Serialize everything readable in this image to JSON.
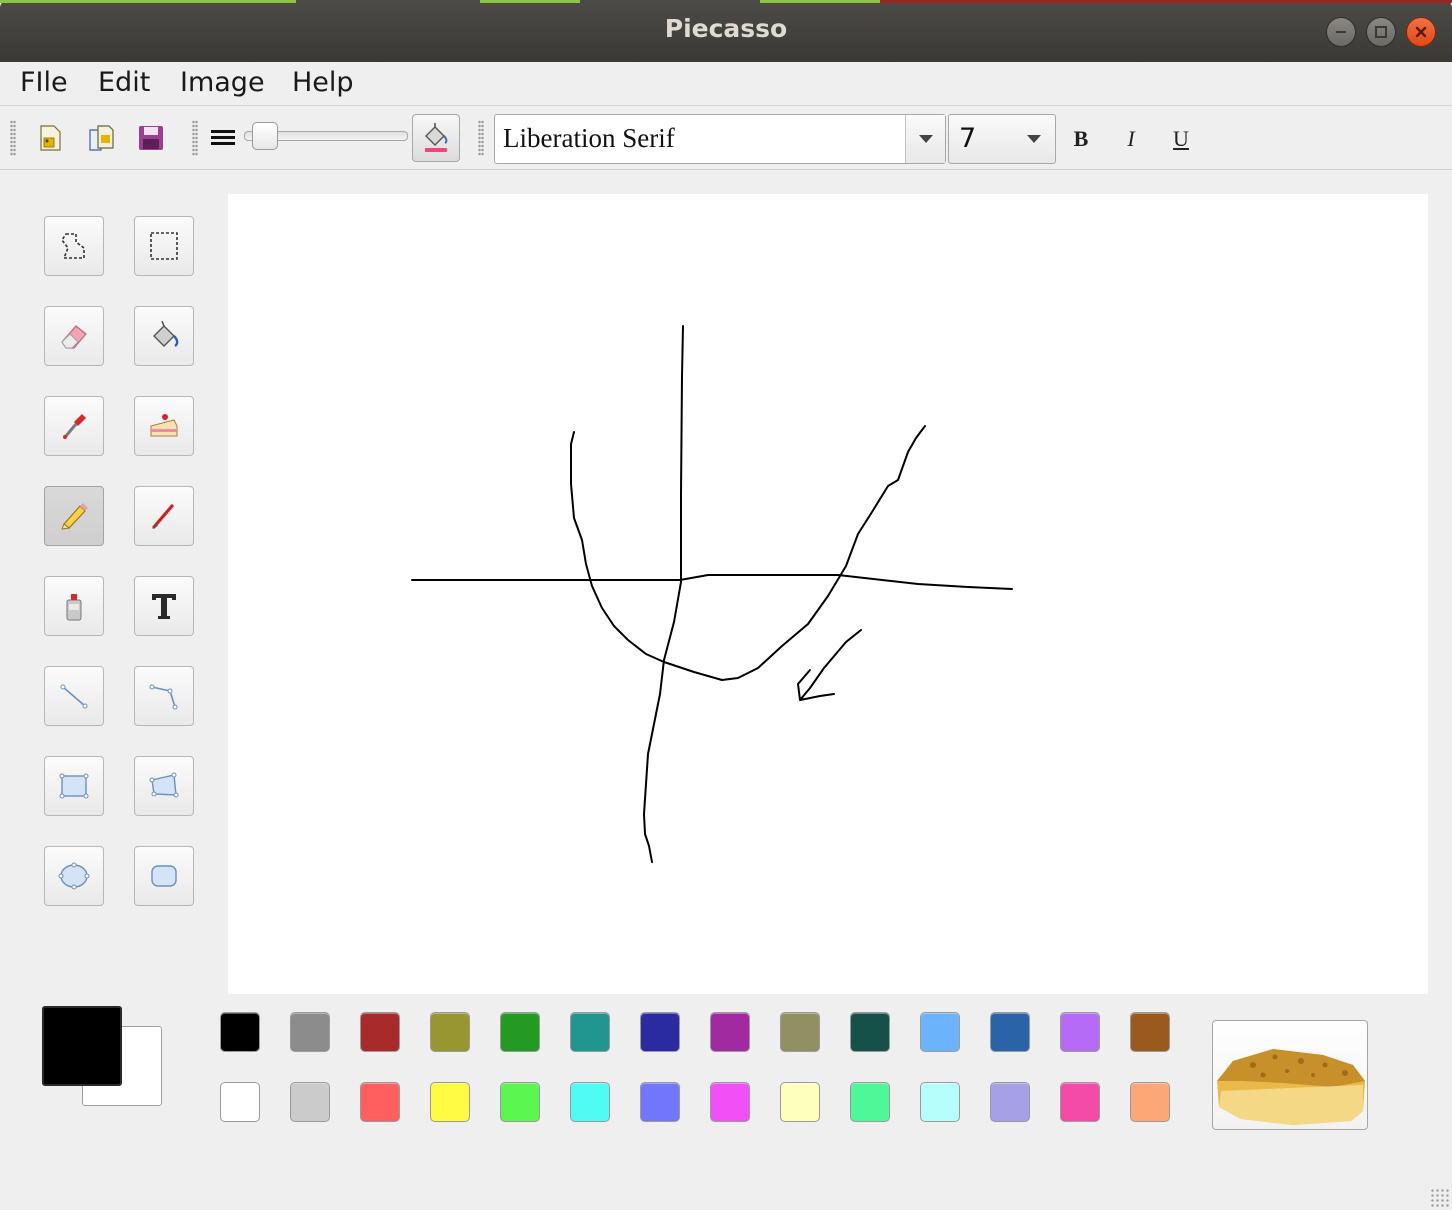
{
  "window": {
    "title": "Piecasso",
    "accent_colors": [
      "#8cc63f",
      "#efefef",
      "#8cc63f",
      "#b32d2d"
    ]
  },
  "menu": [
    "FIle",
    "Edit",
    "Image",
    "Help"
  ],
  "toolbar": {
    "font_name": "Liberation Serif",
    "font_size": "7",
    "bold_label": "B",
    "italic_label": "I",
    "underline_label": "U",
    "line_width_fraction": 0.05
  },
  "tools": [
    {
      "name": "free-select-tool",
      "icon": "lasso-icon"
    },
    {
      "name": "rect-select-tool",
      "icon": "rect-select-icon"
    },
    {
      "name": "eraser-tool",
      "icon": "eraser-icon"
    },
    {
      "name": "fill-tool",
      "icon": "paint-bucket-icon"
    },
    {
      "name": "dropper-tool",
      "icon": "eyedropper-icon"
    },
    {
      "name": "stamp-tool",
      "icon": "cake-icon"
    },
    {
      "name": "pencil-tool",
      "icon": "pencil-icon",
      "active": true
    },
    {
      "name": "brush-tool",
      "icon": "brush-icon"
    },
    {
      "name": "spray-tool",
      "icon": "spray-can-icon"
    },
    {
      "name": "text-tool",
      "icon": "text-icon"
    },
    {
      "name": "line-tool",
      "icon": "line-icon"
    },
    {
      "name": "polyline-tool",
      "icon": "polyline-icon"
    },
    {
      "name": "rectangle-tool",
      "icon": "rectangle-icon"
    },
    {
      "name": "polygon-tool",
      "icon": "polygon-icon"
    },
    {
      "name": "ellipse-tool",
      "icon": "ellipse-icon"
    },
    {
      "name": "rounded-rect-tool",
      "icon": "rounded-rect-icon"
    }
  ],
  "colors": {
    "primary": "#000000",
    "secondary": "#ffffff",
    "palette_row1": [
      "#000000",
      "#8c8c8c",
      "#a82a2a",
      "#989631",
      "#239b23",
      "#21958f",
      "#2a2ba0",
      "#a12aa0",
      "#919062",
      "#165149",
      "#6cb3fe",
      "#2b63a8",
      "#b66bf7",
      "#9a5a1e"
    ],
    "palette_row2": [
      "#ffffff",
      "#cbcbcb",
      "#ff5f5f",
      "#fffb44",
      "#5cf650",
      "#50fbf4",
      "#7077fd",
      "#f050f6",
      "#fefebd",
      "#4ef898",
      "#b5fefc",
      "#a6a1e6",
      "#f44ba8",
      "#fea776"
    ]
  }
}
